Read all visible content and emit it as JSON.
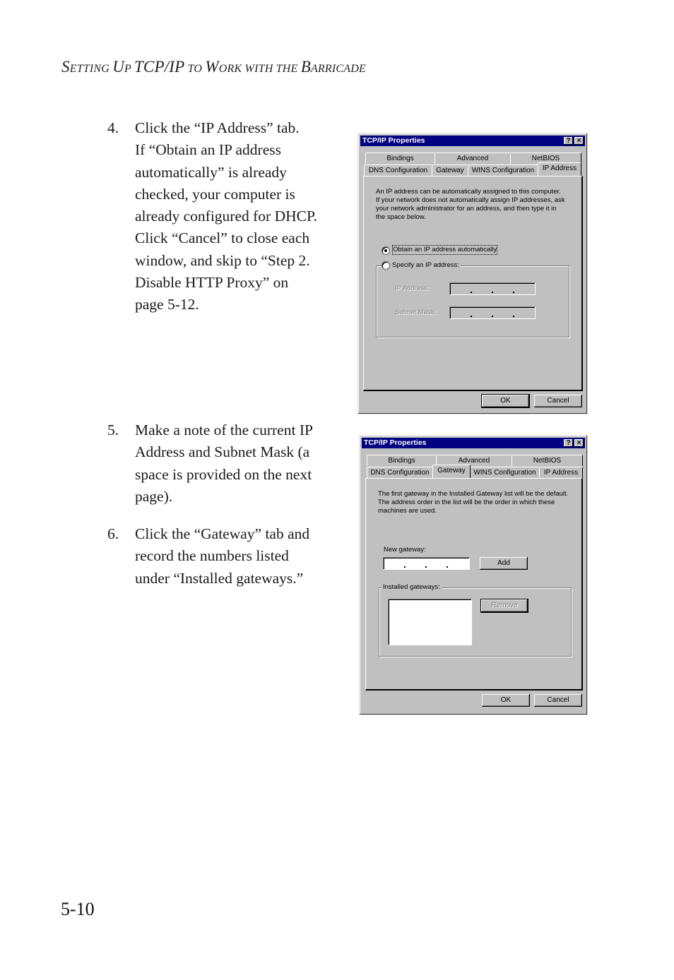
{
  "header": {
    "running_head_parts": [
      "S",
      "etting ",
      "U",
      "p ",
      "TCP/IP",
      " to ",
      "W",
      "ork with the ",
      "B",
      "arricade"
    ]
  },
  "steps": [
    {
      "number": "4.",
      "text": "Click the “IP Address” tab.\nIf “Obtain an IP address\nautomatically” is already\nchecked, your computer is\nalready configured for DHCP.\nClick “Cancel” to close each\nwindow, and skip to “Step 2.\nDisable HTTP Proxy” on\npage 5-12."
    },
    {
      "number": "5.",
      "text": "Make a note of the current IP\nAddress and Subnet Mask (a\nspace is provided on the next\npage)."
    },
    {
      "number": "6.",
      "text": "Click the “Gateway” tab and\nrecord the numbers listed\nunder “Installed gateways.”"
    }
  ],
  "page_number": "5-10",
  "dialog1": {
    "title": "TCP/IP Properties",
    "help_glyph": "?",
    "close_glyph": "×",
    "tabs_row1": [
      "Bindings",
      "Advanced",
      "NetBIOS"
    ],
    "tabs_row2": [
      "DNS Configuration",
      "Gateway",
      "WINS Configuration",
      "IP Address"
    ],
    "active_tab": "IP Address",
    "description": "An IP address can be automatically assigned to this computer.\nIf your network does not automatically assign IP addresses, ask\nyour network administrator for an address, and then type it in\nthe space below.",
    "radio_obtain": {
      "label": "Obtain an IP address automatically",
      "selected": true
    },
    "radio_specify": {
      "label": "Specify an IP address:",
      "selected": false
    },
    "ip_address_label": "IP Address:",
    "subnet_mask_label": "Subnet Mask:",
    "ip_address_value": "",
    "subnet_mask_value": "",
    "ok_label": "OK",
    "cancel_label": "Cancel"
  },
  "dialog2": {
    "title": "TCP/IP Properties",
    "help_glyph": "?",
    "close_glyph": "×",
    "tabs_row1": [
      "Bindings",
      "Advanced",
      "NetBIOS"
    ],
    "tabs_row2": [
      "DNS Configuration",
      "Gateway",
      "WINS Configuration",
      "IP Address"
    ],
    "active_tab": "Gateway",
    "description": "The first gateway in the Installed Gateway list will be the default.\nThe address order in the list will be the order in which these\nmachines are used.",
    "new_gateway_label": "New gateway:",
    "new_gateway_value": "",
    "add_label": "Add",
    "installed_gateways_label": "Installed gateways:",
    "installed_gateways": [],
    "remove_label": "Remove",
    "ok_label": "OK",
    "cancel_label": "Cancel"
  }
}
